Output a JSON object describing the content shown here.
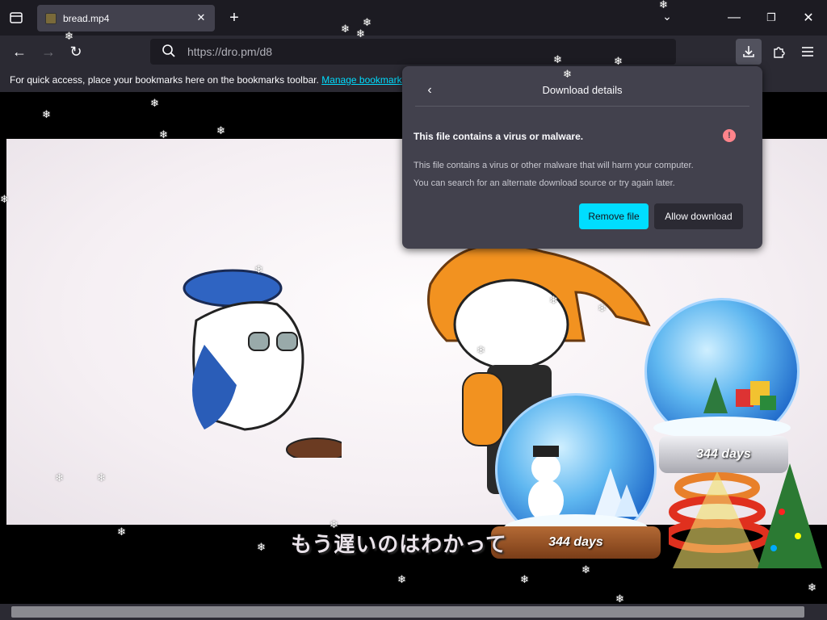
{
  "browser": {
    "tab": {
      "title": "bread.mp4"
    },
    "address": {
      "url": "https://dro.pm/d8"
    },
    "bookmarks_bar": {
      "text": "For quick access, place your bookmarks here on the bookmarks toolbar.",
      "link": "Manage bookmarks"
    }
  },
  "download_panel": {
    "title": "Download details",
    "warning_title": "This file contains a virus or malware.",
    "description_line1": "This file contains a virus or other malware that will harm your computer.",
    "description_line2": "You can search for an alternate download source or try again later.",
    "remove_label": "Remove file",
    "allow_label": "Allow download"
  },
  "video": {
    "subtitle": "もう遅いのはわかって",
    "globe_left_label": "344 days",
    "globe_right_label": "344 days"
  },
  "colors": {
    "accent": "#00ddff",
    "warning": "#ff848b",
    "panel_bg": "#42414d"
  }
}
